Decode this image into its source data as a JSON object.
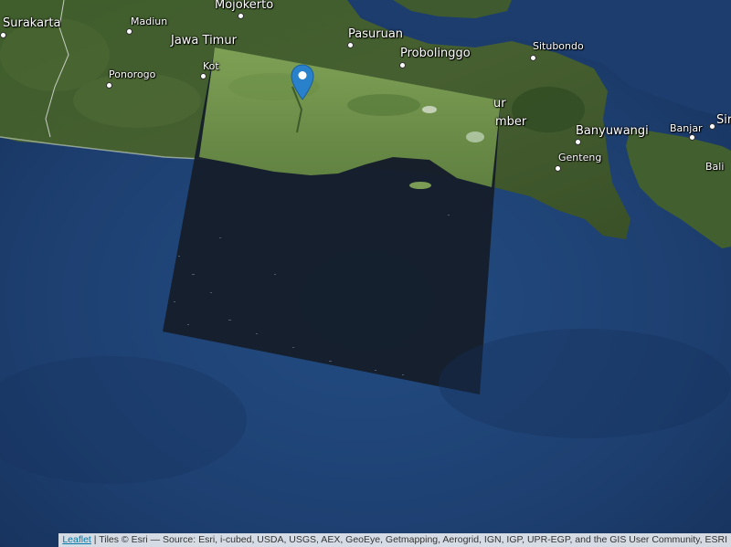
{
  "map": {
    "places": [
      {
        "id": "surakarta",
        "label": "Surakarta",
        "size": "big"
      },
      {
        "id": "madiun",
        "label": "Madiun",
        "size": "small"
      },
      {
        "id": "mojokerto",
        "label": "Mojokerto",
        "size": "big"
      },
      {
        "id": "jawa-timur",
        "label": "Jawa Timur",
        "size": "big"
      },
      {
        "id": "pasuruan",
        "label": "Pasuruan",
        "size": "big"
      },
      {
        "id": "probolinggo",
        "label": "Probolinggo",
        "size": "big"
      },
      {
        "id": "situbondo",
        "label": "Situbondo",
        "size": "small"
      },
      {
        "id": "ponorogo",
        "label": "Ponorogo",
        "size": "small"
      },
      {
        "id": "kota",
        "label": "Kot",
        "size": "small"
      },
      {
        "id": "jember",
        "label": "mber",
        "size": "big"
      },
      {
        "id": "jember-partial",
        "label": "ur",
        "size": "big"
      },
      {
        "id": "banyuwangi",
        "label": "Banyuwangi",
        "size": "big"
      },
      {
        "id": "genteng",
        "label": "Genteng",
        "size": "small"
      },
      {
        "id": "banjar",
        "label": "Banjar",
        "size": "small"
      },
      {
        "id": "bali",
        "label": "Bali",
        "size": "small"
      },
      {
        "id": "singaraja-partial",
        "label": "Sir",
        "size": "big"
      }
    ],
    "marker_icon": "map-pin-icon",
    "marker_color": "#2a81cb",
    "land_color": "#3c5a2a",
    "ocean_color": "#1f4273"
  },
  "attribution": {
    "link_text": "Leaflet",
    "text": " | Tiles © Esri — Source: Esri, i-cubed, USDA, USGS, AEX, GeoEye, Getmapping, Aerogrid, IGN, IGP, UPR-EGP, and the GIS User Community, ESRI"
  }
}
